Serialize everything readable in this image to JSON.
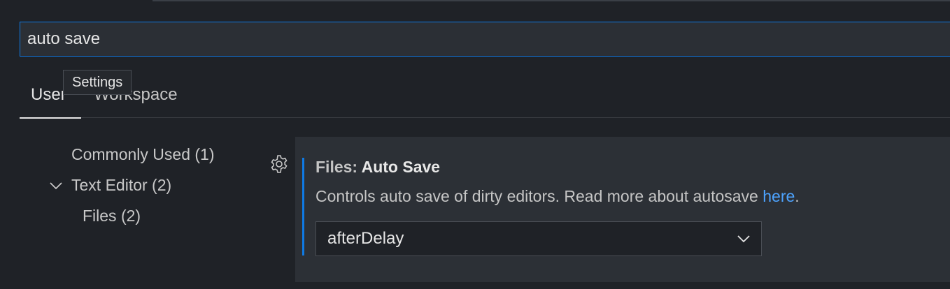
{
  "search": {
    "value": "auto save"
  },
  "tooltip": {
    "text": "Settings"
  },
  "tabs": [
    {
      "label": "User",
      "active": true
    },
    {
      "label": "Workspace",
      "active": false
    }
  ],
  "toc": {
    "commonly_used": "Commonly Used (1)",
    "text_editor": "Text Editor (2)",
    "files": "Files (2)"
  },
  "setting": {
    "category": "Files: ",
    "name": "Auto Save",
    "description_prefix": "Controls auto save of dirty editors. Read more about autosave ",
    "description_link": "here",
    "description_suffix": ".",
    "value": "afterDelay"
  },
  "colors": {
    "accent": "#0f7ae5",
    "link": "#4da3ff",
    "background": "#1f2227",
    "panel": "#2c3036"
  }
}
